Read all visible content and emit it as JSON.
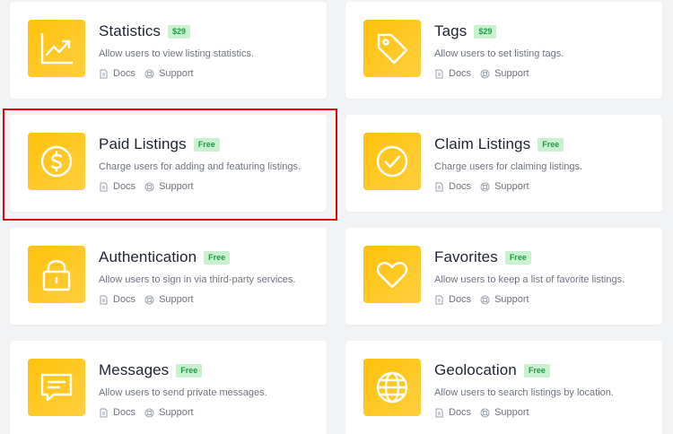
{
  "labels": {
    "docs": "Docs",
    "support": "Support"
  },
  "colors": {
    "icon_bg": "#ffc10a",
    "badge_bg": "#c9f0cf",
    "badge_text": "#23994a",
    "highlight": "#e3000f"
  },
  "cards": [
    {
      "title": "Statistics",
      "badge": "$29",
      "description": "Allow users to view listing statistics.",
      "icon": "chart-icon"
    },
    {
      "title": "Tags",
      "badge": "$29",
      "description": "Allow users to set listing tags.",
      "icon": "tag-icon"
    },
    {
      "title": "Paid Listings",
      "badge": "Free",
      "description": "Charge users for adding and featuring listings.",
      "icon": "dollar-icon"
    },
    {
      "title": "Claim Listings",
      "badge": "Free",
      "description": "Charge users for claiming listings.",
      "icon": "check-circle-icon"
    },
    {
      "title": "Authentication",
      "badge": "Free",
      "description": "Allow users to sign in via third-party services.",
      "icon": "lock-icon"
    },
    {
      "title": "Favorites",
      "badge": "Free",
      "description": "Allow users to keep a list of favorite listings.",
      "icon": "heart-icon"
    },
    {
      "title": "Messages",
      "badge": "Free",
      "description": "Allow users to send private messages.",
      "icon": "message-icon"
    },
    {
      "title": "Geolocation",
      "badge": "Free",
      "description": "Allow users to search listings by location.",
      "icon": "globe-icon"
    }
  ]
}
